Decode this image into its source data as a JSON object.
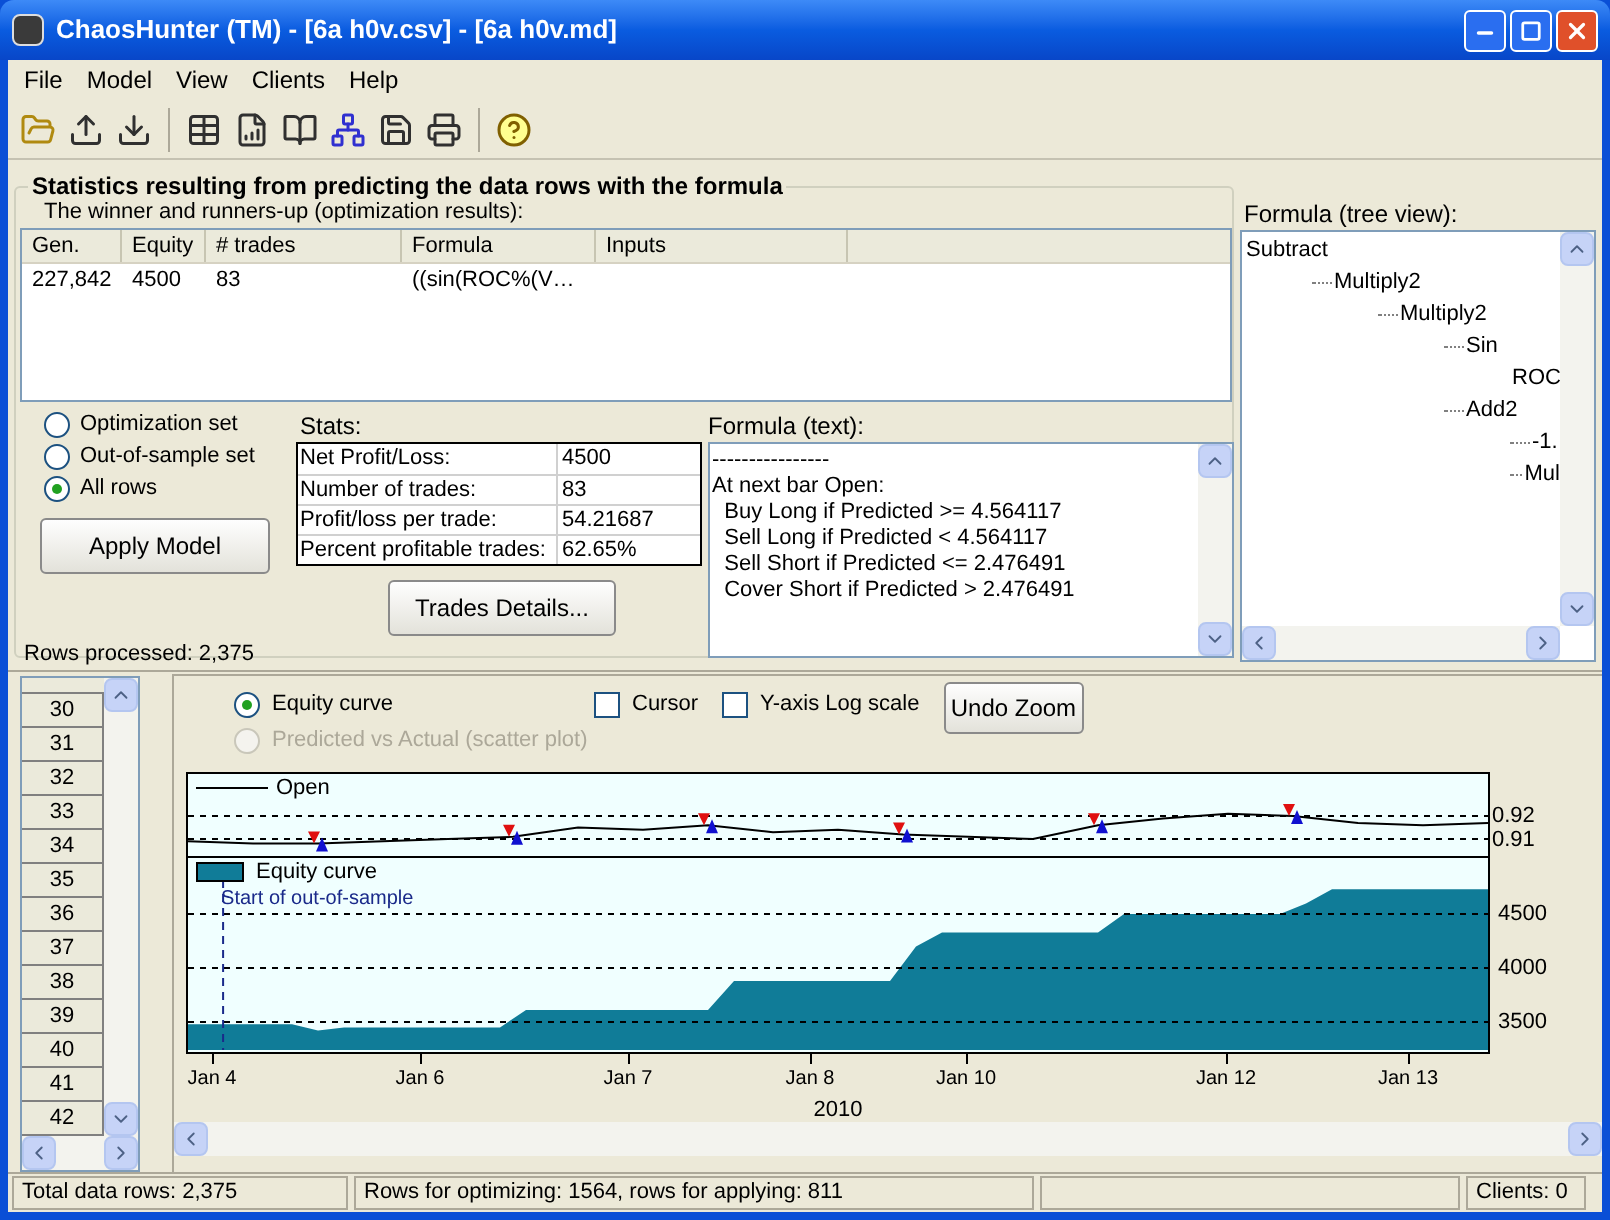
{
  "window": {
    "title": "ChaosHunter (TM) - [6a h0v.csv] - [6a h0v.md]"
  },
  "menu": [
    "File",
    "Model",
    "View",
    "Clients",
    "Help"
  ],
  "statistics": {
    "title": "Statistics resulting from predicting the data rows with the formula",
    "results_label": "The winner and runners-up (optimization results):",
    "columns": [
      "Gen.",
      "Equity",
      "# trades",
      "Formula",
      "Inputs"
    ],
    "rows": [
      [
        "227,842",
        "4500",
        "83",
        "((sin(ROC%(V…"
      ]
    ]
  },
  "row_sets": [
    {
      "label": "Optimization set",
      "selected": false
    },
    {
      "label": "Out-of-sample set",
      "selected": false
    },
    {
      "label": "All rows",
      "selected": true
    }
  ],
  "apply_button": "Apply Model",
  "stats": {
    "label": "Stats:",
    "rows": [
      [
        "Net Profit/Loss:",
        "4500"
      ],
      [
        "Number of trades:",
        "83"
      ],
      [
        "Profit/loss per trade:",
        "54.21687"
      ],
      [
        "Percent profitable trades:",
        "62.65%"
      ]
    ]
  },
  "trades_button": "Trades Details...",
  "formula_text": {
    "label": "Formula (text):",
    "lines": [
      "----------------",
      "At next bar Open:",
      "  Buy Long if Predicted >= 4.564117",
      "  Sell Long if Predicted < 4.564117",
      "  Sell Short if Predicted <= 2.476491",
      "  Cover Short if Predicted > 2.476491"
    ]
  },
  "rows_processed": "Rows processed: 2,375",
  "formula_tree": {
    "label": "Formula (tree view):",
    "root": {
      "label": "Subtract",
      "children": [
        {
          "label": "Multiply2",
          "children": [
            {
              "label": "Multiply2",
              "children": [
                {
                  "label": "Sin",
                  "children": [
                    {
                      "label": "ROC"
                    }
                  ]
                },
                {
                  "label": "Add2",
                  "children": [
                    {
                      "label": "-1."
                    },
                    {
                      "label": "Mul"
                    }
                  ]
                }
              ]
            }
          ]
        }
      ]
    }
  },
  "row_numbers": [
    "30",
    "31",
    "32",
    "33",
    "34",
    "35",
    "36",
    "37",
    "38",
    "39",
    "40",
    "41",
    "42"
  ],
  "chart_options": {
    "modes": [
      {
        "label": "Equity curve",
        "selected": true,
        "disabled": false
      },
      {
        "label": "Predicted vs Actual (scatter plot)",
        "selected": false,
        "disabled": true
      }
    ],
    "checkboxes": [
      {
        "label": "Cursor",
        "checked": false
      },
      {
        "label": "Y-axis Log scale",
        "checked": false
      }
    ],
    "undo_button": "Undo Zoom"
  },
  "price_chart": {
    "chart_data": {
      "type": "line",
      "categories": [
        null,
        null,
        null,
        null,
        null,
        null,
        null,
        null,
        null,
        null,
        null,
        null,
        null,
        null,
        null,
        null,
        null,
        null,
        null,
        null,
        null
      ],
      "series": [
        {
          "name": "Open",
          "color": "#000000",
          "values": [
            0.909,
            0.908,
            0.908,
            0.909,
            0.91,
            0.911,
            0.915,
            0.914,
            0.916,
            0.913,
            0.914,
            0.912,
            0.911,
            0.91,
            0.916,
            0.919,
            0.921,
            0.92,
            0.917,
            0.916,
            0.917
          ]
        }
      ],
      "ylim": [
        0.9026,
        0.9383
      ],
      "yticks": [
        0.91,
        0.92
      ],
      "grid": true
    }
  },
  "equity_chart": {
    "chart_data": {
      "type": "area",
      "xlabel": "2010",
      "categories": [
        null,
        "Jan 4",
        null,
        null,
        null,
        null,
        null,
        null,
        null,
        "Jan 6",
        null,
        null,
        null,
        null,
        null,
        null,
        null,
        "Jan 7",
        null,
        null,
        null,
        null,
        null,
        null,
        "Jan 8",
        null,
        null,
        null,
        null,
        null,
        "Jan 10",
        null,
        null,
        null,
        null,
        null,
        null,
        null,
        null,
        null,
        "Jan 12",
        null,
        null,
        null,
        null,
        null,
        null,
        "Jan 13",
        null,
        null,
        null
      ],
      "series": [
        {
          "name": "Equity curve",
          "color": "#107c98",
          "values": [
            3480,
            3480,
            3480,
            3480,
            3480,
            3420,
            3450,
            3450,
            3450,
            3450,
            3450,
            3450,
            3450,
            3610,
            3610,
            3610,
            3610,
            3610,
            3610,
            3610,
            3610,
            3880,
            3880,
            3880,
            3880,
            3880,
            3880,
            3880,
            4200,
            4330,
            4330,
            4330,
            4330,
            4330,
            4330,
            4330,
            4500,
            4500,
            4500,
            4500,
            4500,
            4500,
            4500,
            4600,
            4730,
            4730,
            4730,
            4730,
            4730,
            4730,
            4730
          ]
        }
      ],
      "ylim": [
        3240,
        5020
      ],
      "yticks": [
        3500,
        4000,
        4500
      ],
      "grid": true,
      "annotations": [
        "Start of out-of-sample"
      ]
    }
  },
  "status_bar": [
    "Total data rows: 2,375",
    "Rows for optimizing: 1564, rows for applying: 811",
    "Clients: 0"
  ]
}
